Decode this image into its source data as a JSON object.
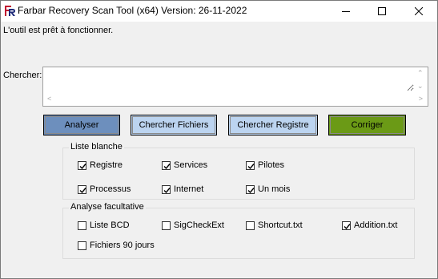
{
  "window": {
    "title": "Farbar Recovery Scan Tool (x64) Version: 26-11-2022",
    "icon": "frst-logo"
  },
  "status_text": "L'outil est prêt à fonctionner.",
  "search": {
    "label": "Chercher:",
    "value": ""
  },
  "buttons": {
    "analyser": "Analyser",
    "chercher_fichiers": "Chercher Fichiers",
    "chercher_registre": "Chercher Registre",
    "corriger": "Corriger"
  },
  "colors": {
    "analyser_bg": "#6d8fbd",
    "search_buttons_bg": "#bcd4f0",
    "corriger_bg": "#6b9a16"
  },
  "whitelist": {
    "title": "Liste blanche",
    "items": [
      {
        "label": "Registre",
        "checked": true
      },
      {
        "label": "Services",
        "checked": true
      },
      {
        "label": "Pilotes",
        "checked": true
      },
      {
        "label": "Processus",
        "checked": true
      },
      {
        "label": "Internet",
        "checked": true
      },
      {
        "label": "Un mois",
        "checked": true
      }
    ]
  },
  "optional_scan": {
    "title": "Analyse facultative",
    "items": [
      {
        "label": "Liste BCD",
        "checked": false
      },
      {
        "label": "SigCheckExt",
        "checked": false
      },
      {
        "label": "Shortcut.txt",
        "checked": false
      },
      {
        "label": "Addition.txt",
        "checked": true
      },
      {
        "label": "Fichiers 90 jours",
        "checked": false
      }
    ]
  }
}
